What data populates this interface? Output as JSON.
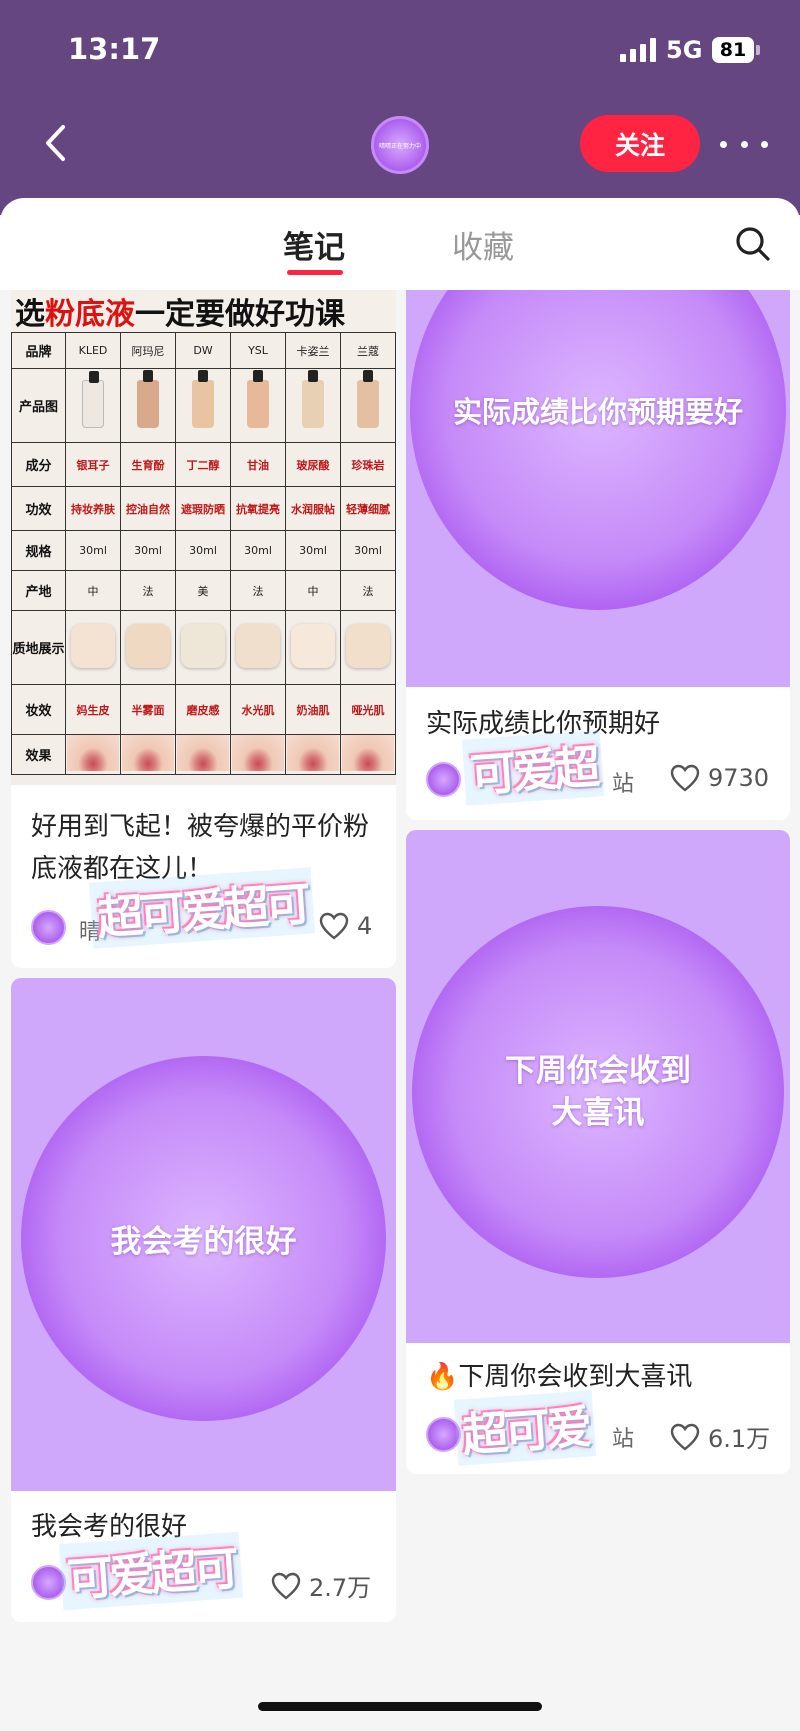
{
  "status_bar": {
    "time": "13:17",
    "network": "5G",
    "battery": "81"
  },
  "header": {
    "follow_label": "关注",
    "avatar_text": "晴晴正在努力中"
  },
  "tabs": [
    {
      "label": "笔记",
      "active": true
    },
    {
      "label": "收藏",
      "active": false
    }
  ],
  "notes": {
    "left": [
      {
        "type": "foundation-chart",
        "chart": {
          "title_parts": [
            "选 ",
            "粉底液",
            " 一定要做好功课"
          ],
          "brands": [
            "KLED",
            "阿玛尼",
            "DW",
            "YSL",
            "卡姿兰",
            "兰蔻"
          ],
          "rows": [
            {
              "label": "产品图",
              "values": []
            },
            {
              "label": "成分",
              "values": [
                "银耳子",
                "生育酚",
                "丁二醇",
                "甘油",
                "玻尿酸",
                "珍珠岩"
              ]
            },
            {
              "label": "功效",
              "values": [
                "持妆养肤",
                "控油自然",
                "遮瑕防晒",
                "抗氧提亮",
                "水润服帖",
                "轻薄细腻"
              ]
            },
            {
              "label": "规格",
              "values": [
                "30ml",
                "30ml",
                "30ml",
                "30ml",
                "30ml",
                "30ml"
              ]
            },
            {
              "label": "产地",
              "values": [
                "中",
                "法",
                "美",
                "法",
                "中",
                "法"
              ]
            },
            {
              "label": "质地展示",
              "values": []
            },
            {
              "label": "妆效",
              "values": [
                "妈生皮",
                "半雾面",
                "磨皮感",
                "水光肌",
                "奶油肌",
                "哑光肌"
              ]
            },
            {
              "label": "效果",
              "values": []
            }
          ],
          "brand_header": "品牌"
        },
        "title": "好用到飞起！被夸爆的平价粉底液都在这儿！",
        "author": "晴",
        "likes": "4",
        "sticker": "超可爱超可"
      },
      {
        "type": "orb",
        "orb_text": "我会考的很好",
        "title": "我会考的很好",
        "likes": "2.7万",
        "sticker": "可爱超可"
      }
    ],
    "right": [
      {
        "type": "orb",
        "orb_text": "实际成绩比你预期要好",
        "title": "实际成绩比你预期好",
        "author_tail": "站",
        "likes": "9730",
        "sticker": "可爱超"
      },
      {
        "type": "orb",
        "orb_text": "下周你会收到大喜讯",
        "title": "🔥下周你会收到大喜讯",
        "author_tail": "站",
        "likes": "6.1万",
        "sticker": "超可爱"
      }
    ]
  },
  "colors": {
    "header": "#664680",
    "accent": "#ff2442",
    "orb_bg": "#cfa8fb"
  },
  "icons": [
    "signal-icon",
    "battery-icon",
    "back-chevron-icon",
    "more-dots-icon",
    "search-icon",
    "heart-icon",
    "fire-icon"
  ]
}
